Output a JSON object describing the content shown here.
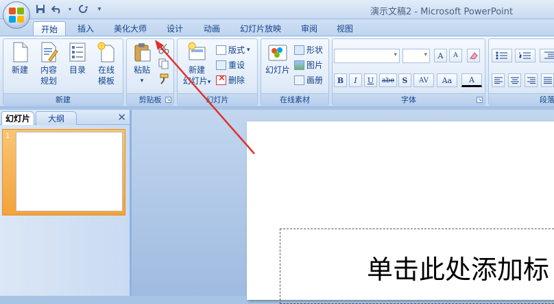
{
  "window": {
    "title": "演示文稿2 - Microsoft PowerPoint"
  },
  "qat": {
    "save_icon": "save-icon",
    "undo_icon": "undo-icon",
    "redo_icon": "redo-icon",
    "customize_icon": "customize-icon"
  },
  "tabs": [
    {
      "label": "开始"
    },
    {
      "label": "插入"
    },
    {
      "label": "美化大师"
    },
    {
      "label": "设计"
    },
    {
      "label": "动画"
    },
    {
      "label": "幻灯片放映"
    },
    {
      "label": "审阅"
    },
    {
      "label": "视图"
    }
  ],
  "ribbon": {
    "new_group": {
      "label": "新建",
      "buttons": [
        {
          "label": "新建",
          "label2": ""
        },
        {
          "label": "内容",
          "label2": "规划"
        },
        {
          "label": "目录",
          "label2": ""
        },
        {
          "label": "在线",
          "label2": "模板"
        }
      ]
    },
    "clipboard_group": {
      "label": "剪贴板",
      "paste_label": "粘贴"
    },
    "slides_group": {
      "label": "幻灯片",
      "new_slide_1": "新建",
      "new_slide_2": "幻灯片",
      "layout_label": "版式",
      "reset_label": "重设",
      "delete_label": "删除"
    },
    "online_group": {
      "label": "在线素材",
      "slide_label": "幻灯片",
      "shape_label": "形状",
      "picture_label": "图片",
      "frame_label": "画册"
    },
    "font_group": {
      "label": "字体",
      "font_name": "",
      "font_size": "",
      "bold": "B",
      "italic": "I",
      "underline": "U",
      "strike": "abe",
      "shadow": "S",
      "spacing": "AV",
      "case": "Aa",
      "color": "A",
      "grow": "A",
      "shrink": "A"
    },
    "paragraph_group": {
      "label": "段落"
    }
  },
  "panel": {
    "tab_slides": "幻灯片",
    "tab_outline": "大纲",
    "slide_number": "1"
  },
  "slide": {
    "title_placeholder": "单击此处添加标"
  },
  "colors": {
    "accent": "#15428b",
    "selection": "#f3a33a",
    "arrow": "#e0312b"
  }
}
